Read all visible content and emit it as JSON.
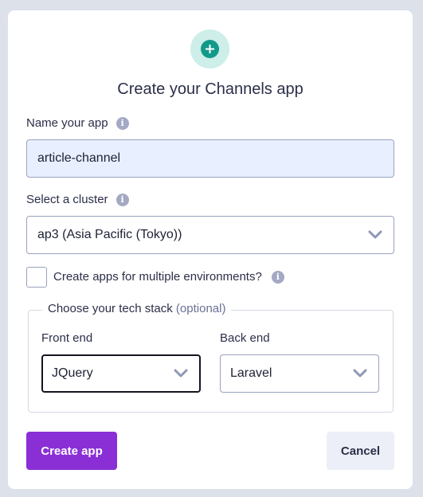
{
  "modal": {
    "title": "Create your Channels app",
    "icon": "plus-circle-icon",
    "accent_color": "#13998a"
  },
  "name_field": {
    "label": "Name your app",
    "value": "article-channel"
  },
  "cluster_field": {
    "label": "Select a cluster",
    "value": "ap3 (Asia Pacific (Tokyo))"
  },
  "environments": {
    "label": "Create apps for multiple environments?",
    "checked": false
  },
  "tech_stack": {
    "legend": "Choose your tech stack",
    "legend_optional": "(optional)",
    "front_end": {
      "label": "Front end",
      "value": "JQuery"
    },
    "back_end": {
      "label": "Back end",
      "value": "Laravel"
    }
  },
  "actions": {
    "create_label": "Create app",
    "create_color": "#8a2fd6",
    "cancel_label": "Cancel"
  }
}
